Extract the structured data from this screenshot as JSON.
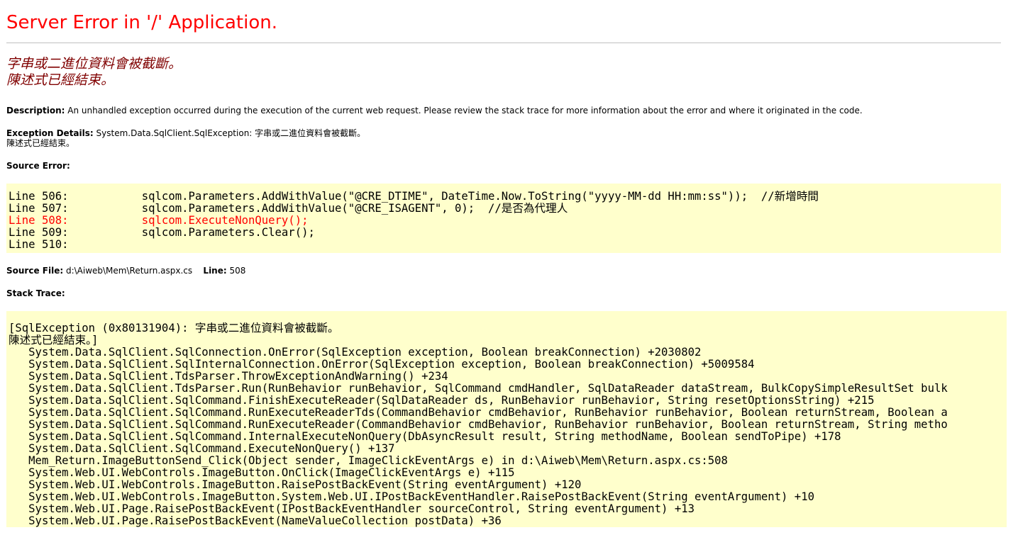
{
  "title": "Server Error in '/' Application.",
  "error_message": [
    "字串或二進位資料會被截斷。",
    "陳述式已經結束。"
  ],
  "description": {
    "label": "Description:",
    "text": " An unhandled exception occurred during the execution of the current web request. Please review the stack trace for more information about the error and where it originated in the code."
  },
  "exception_details": {
    "label": "Exception Details:",
    "text": " System.Data.SqlClient.SqlException: 字串或二進位資料會被截斷。",
    "text2": "陳述式已經結束。"
  },
  "source_error": {
    "label": "Source Error:",
    "lines": [
      {
        "text": "Line 506:           sqlcom.Parameters.AddWithValue(\"@CRE_DTIME\", DateTime.Now.ToString(\"yyyy-MM-dd HH:mm:ss\"));  //新增時間",
        "error": false
      },
      {
        "text": "Line 507:           sqlcom.Parameters.AddWithValue(\"@CRE_ISAGENT\", 0);  //是否為代理人",
        "error": false
      },
      {
        "text": "Line 508:           sqlcom.ExecuteNonQuery();",
        "error": true
      },
      {
        "text": "Line 509:           sqlcom.Parameters.Clear();",
        "error": false
      },
      {
        "text": "Line 510:",
        "error": false
      }
    ]
  },
  "source_file": {
    "label": "Source File:",
    "value": " d:\\Aiweb\\Mem\\Return.aspx.cs",
    "line_label": "Line:",
    "line_value": " 508"
  },
  "stack_trace": {
    "label": "Stack Trace:",
    "lines": [
      "[SqlException (0x80131904): 字串或二進位資料會被截斷。",
      "陳述式已經結束。]",
      "   System.Data.SqlClient.SqlConnection.OnError(SqlException exception, Boolean breakConnection) +2030802",
      "   System.Data.SqlClient.SqlInternalConnection.OnError(SqlException exception, Boolean breakConnection) +5009584",
      "   System.Data.SqlClient.TdsParser.ThrowExceptionAndWarning() +234",
      "   System.Data.SqlClient.TdsParser.Run(RunBehavior runBehavior, SqlCommand cmdHandler, SqlDataReader dataStream, BulkCopySimpleResultSet bulk",
      "   System.Data.SqlClient.SqlCommand.FinishExecuteReader(SqlDataReader ds, RunBehavior runBehavior, String resetOptionsString) +215",
      "   System.Data.SqlClient.SqlCommand.RunExecuteReaderTds(CommandBehavior cmdBehavior, RunBehavior runBehavior, Boolean returnStream, Boolean a",
      "   System.Data.SqlClient.SqlCommand.RunExecuteReader(CommandBehavior cmdBehavior, RunBehavior runBehavior, Boolean returnStream, String metho",
      "   System.Data.SqlClient.SqlCommand.InternalExecuteNonQuery(DbAsyncResult result, String methodName, Boolean sendToPipe) +178",
      "   System.Data.SqlClient.SqlCommand.ExecuteNonQuery() +137",
      "   Mem_Return.ImageButtonSend_Click(Object sender, ImageClickEventArgs e) in d:\\Aiweb\\Mem\\Return.aspx.cs:508",
      "   System.Web.UI.WebControls.ImageButton.OnClick(ImageClickEventArgs e) +115",
      "   System.Web.UI.WebControls.ImageButton.RaisePostBackEvent(String eventArgument) +120",
      "   System.Web.UI.WebControls.ImageButton.System.Web.UI.IPostBackEventHandler.RaisePostBackEvent(String eventArgument) +10",
      "   System.Web.UI.Page.RaisePostBackEvent(IPostBackEventHandler sourceControl, String eventArgument) +13",
      "   System.Web.UI.Page.RaisePostBackEvent(NameValueCollection postData) +36"
    ]
  }
}
